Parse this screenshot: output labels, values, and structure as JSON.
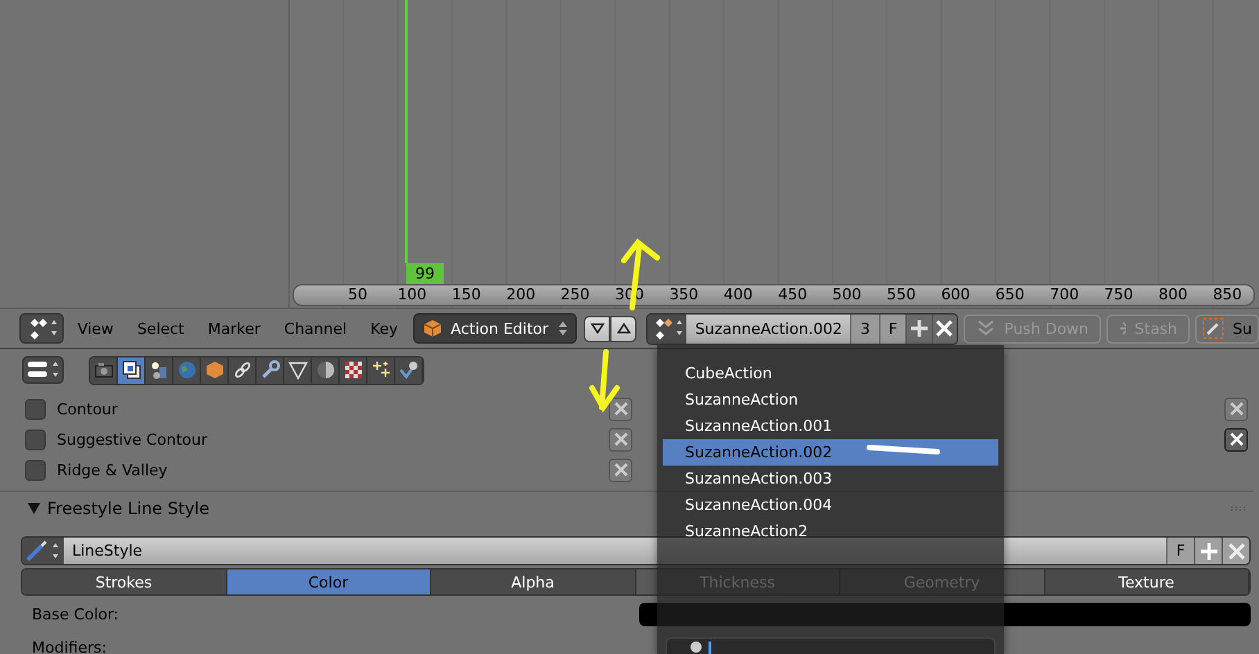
{
  "timeline": {
    "frame_marker": "99",
    "ruler_labels": [
      "50",
      "100",
      "150",
      "200",
      "250",
      "300",
      "350",
      "400",
      "450",
      "500",
      "550",
      "600",
      "650",
      "700",
      "750",
      "800",
      "850"
    ]
  },
  "header": {
    "menus": [
      "View",
      "Select",
      "Marker",
      "Channel",
      "Key"
    ],
    "mode": "Action Editor",
    "action_name": "SuzanneAction.002",
    "users": "3",
    "fake_user": "F",
    "push_down": "Push Down",
    "stash": "Stash",
    "cut_off_label": "Su"
  },
  "action_menu": {
    "items": [
      {
        "label": "CubeAction",
        "selected": false
      },
      {
        "label": "SuzanneAction",
        "selected": false
      },
      {
        "label": "SuzanneAction.001",
        "selected": false
      },
      {
        "label": "SuzanneAction.002",
        "selected": true
      },
      {
        "label": "SuzanneAction.003",
        "selected": false
      },
      {
        "label": "SuzanneAction.004",
        "selected": false
      },
      {
        "label": "SuzanneAction2",
        "selected": false
      }
    ]
  },
  "properties": {
    "context_tabs": [
      {
        "kind": "camera",
        "selected": false
      },
      {
        "kind": "layers",
        "selected": true
      },
      {
        "kind": "scene",
        "selected": false
      },
      {
        "kind": "world",
        "selected": false
      },
      {
        "kind": "cube",
        "selected": false
      },
      {
        "kind": "link",
        "selected": false
      },
      {
        "kind": "wrench",
        "selected": false
      },
      {
        "kind": "vertex",
        "selected": false
      },
      {
        "kind": "material",
        "selected": false
      },
      {
        "kind": "texture",
        "selected": false
      },
      {
        "kind": "particles",
        "selected": false
      },
      {
        "kind": "physics",
        "selected": false
      }
    ],
    "edge_types": [
      {
        "label": "Contour",
        "checked": false
      },
      {
        "label": "Suggestive Contour",
        "checked": false
      },
      {
        "label": "Ridge & Valley",
        "checked": false
      }
    ],
    "panel": {
      "title": "Freestyle Line Style",
      "expanded": true,
      "linestyle": "LineStyle",
      "fake_user": "F",
      "tabs": [
        {
          "label": "Strokes",
          "selected": false
        },
        {
          "label": "Color",
          "selected": true
        },
        {
          "label": "Alpha",
          "selected": false
        },
        {
          "label": "Thickness",
          "selected": false
        },
        {
          "label": "Geometry",
          "selected": false
        },
        {
          "label": "Texture",
          "selected": false
        }
      ],
      "base_color_label": "Base Color:",
      "modifiers_label": "Modifiers:"
    }
  }
}
